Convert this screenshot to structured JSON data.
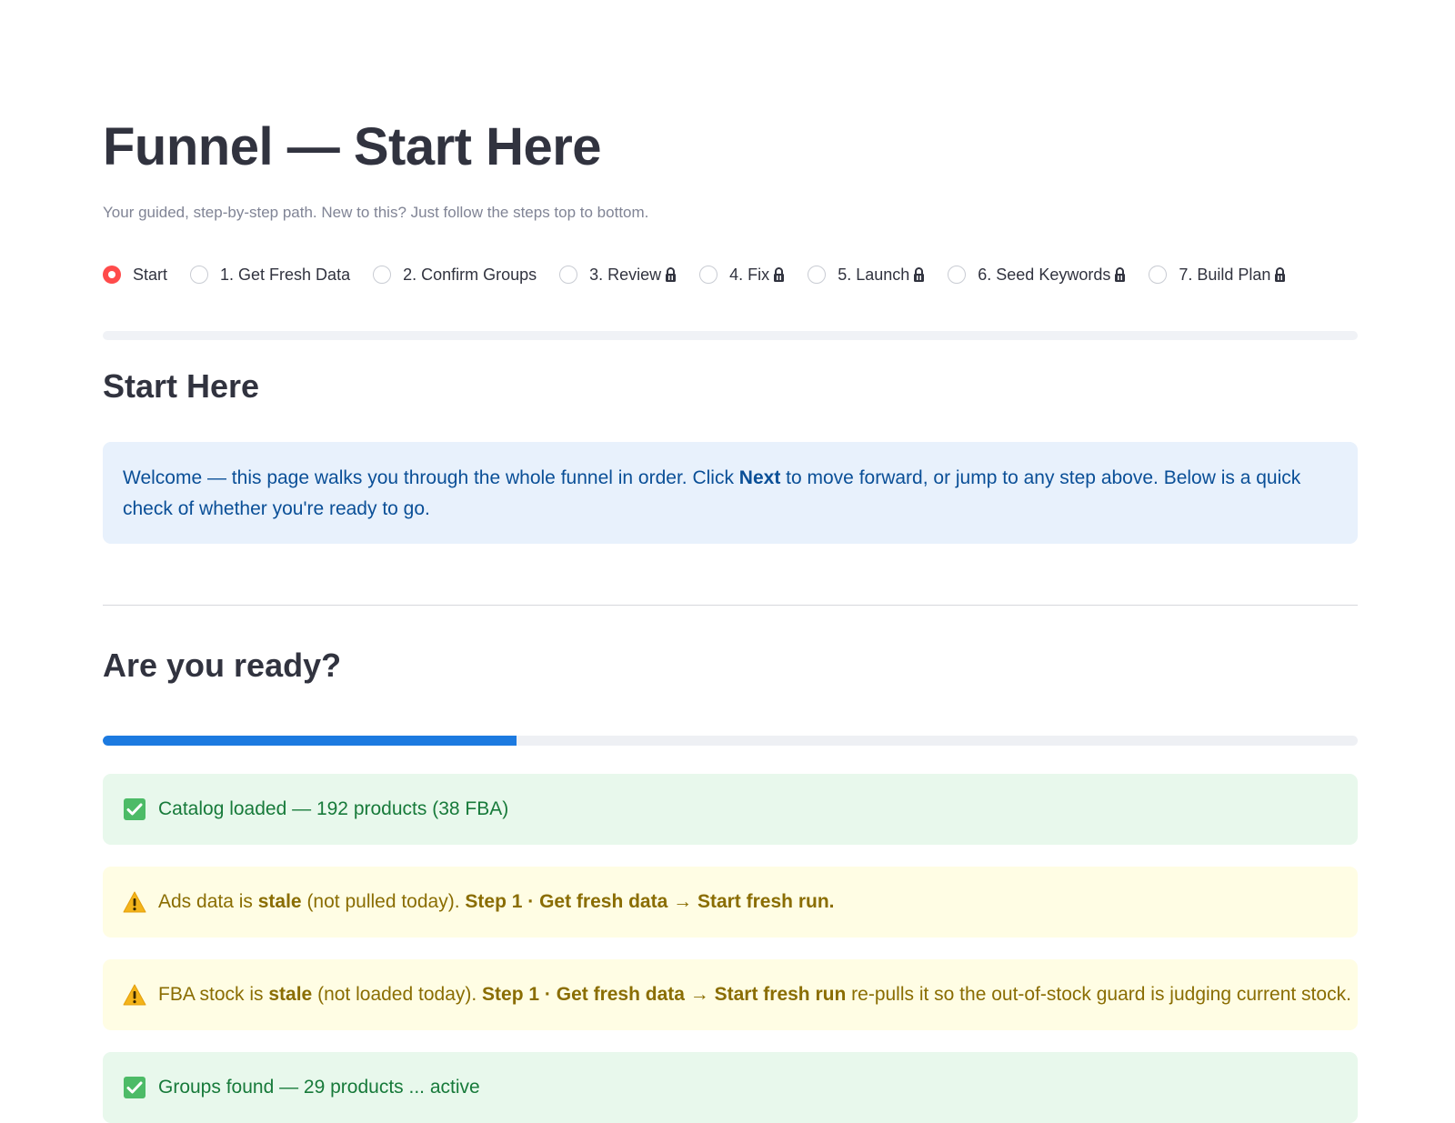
{
  "page": {
    "title": "Funnel — Start Here",
    "caption": "Your guided, step-by-step path. New to this? Just follow the steps top to bottom."
  },
  "steps": [
    {
      "label": "Start",
      "selected": true,
      "locked": false
    },
    {
      "label": "1. Get Fresh Data",
      "selected": false,
      "locked": false
    },
    {
      "label": "2. Confirm Groups",
      "selected": false,
      "locked": false
    },
    {
      "label": "3. Review",
      "selected": false,
      "locked": true
    },
    {
      "label": "4. Fix",
      "selected": false,
      "locked": true
    },
    {
      "label": "5. Launch",
      "selected": false,
      "locked": true
    },
    {
      "label": "6. Seed Keywords",
      "selected": false,
      "locked": true
    },
    {
      "label": "7. Build Plan",
      "selected": false,
      "locked": true
    }
  ],
  "start_section": {
    "heading": "Start Here",
    "info": {
      "before": "Welcome — this page walks you through the whole funnel in order. Click ",
      "bold": "Next",
      "after": " to move forward, or jump to any step above. Below is a quick check of whether you're ready to go."
    }
  },
  "readiness": {
    "heading": "Are you ready?",
    "progress_fraction": 0.33,
    "checks": [
      {
        "status": "success",
        "icon": "check-box-icon",
        "parts": [
          {
            "t": "Catalog loaded — 192 products (38 FBA)",
            "b": false
          }
        ]
      },
      {
        "status": "warning",
        "icon": "warning-icon",
        "parts": [
          {
            "t": "Ads data is ",
            "b": false
          },
          {
            "t": "stale",
            "b": true
          },
          {
            "t": " (not pulled today). ",
            "b": false
          },
          {
            "t": "Step 1 · Get fresh data → Start fresh run.",
            "b": true
          }
        ]
      },
      {
        "status": "warning",
        "icon": "warning-icon",
        "parts": [
          {
            "t": "FBA stock is ",
            "b": false
          },
          {
            "t": "stale",
            "b": true
          },
          {
            "t": " (not loaded today). ",
            "b": false
          },
          {
            "t": "Step 1 · Get fresh data → Start fresh run",
            "b": true
          },
          {
            "t": " re-pulls it so the out-of-stock guard is judging current stock.",
            "b": false
          }
        ]
      },
      {
        "status": "success",
        "icon": "check-box-icon",
        "parts": [
          {
            "t": "Groups found — 29 products ... active",
            "b": false
          }
        ]
      }
    ]
  },
  "colors": {
    "accent_radio": "#ff4b4b",
    "progress": "#1c7ae0",
    "info_bg": "#e8f1fc",
    "success_bg": "#e8f8ec",
    "warning_bg": "#fffde4"
  }
}
